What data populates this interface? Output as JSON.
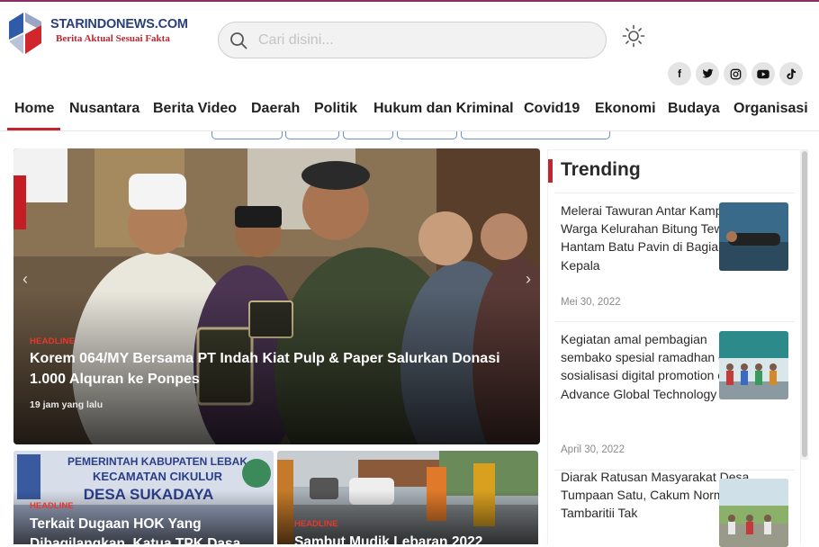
{
  "site": {
    "name": "STARINDONEWS.COM",
    "tagline": "Berita Aktual Sesuai Fakta"
  },
  "search": {
    "placeholder": "Cari disini...",
    "value": ""
  },
  "icons": {
    "theme": "sun-icon",
    "search": "search-icon",
    "socials": [
      "facebook-icon",
      "twitter-icon",
      "instagram-icon",
      "youtube-icon",
      "tiktok-icon"
    ]
  },
  "nav": {
    "items": [
      {
        "label": "Home",
        "active": true
      },
      {
        "label": "Nusantara"
      },
      {
        "label": "Berita Video"
      },
      {
        "label": "Daerah"
      },
      {
        "label": "Politik"
      },
      {
        "label": "Hukum dan Kriminal"
      },
      {
        "label": "Covid19"
      },
      {
        "label": "Ekonomi"
      },
      {
        "label": "Budaya"
      },
      {
        "label": "Organisasi"
      }
    ]
  },
  "hero": {
    "tag": "HEADLINE",
    "title": "Korem 064/MY Bersama PT Indah Kiat Pulp & Paper Salurkan Donasi 1.000 Alquran ke Ponpes",
    "time": "19 jam yang lalu"
  },
  "cards": [
    {
      "tag": "HEADLINE",
      "title": "Terkait Dugaan HOK Yang",
      "title2": "Dibagilangkan, Katua TPK Dasa"
    },
    {
      "tag": "HEADLINE",
      "title": "Sambut Mudik Lebaran 2022"
    }
  ],
  "trending": {
    "heading": "Trending",
    "items": [
      {
        "title": "Melerai Tawuran Antar Kampung, Warga Kelurahan Bitung Tewas di Hantam Batu Pavin di Bagian Kepala",
        "date": "Mei 30, 2022"
      },
      {
        "title": "Kegiatan amal pembagian sembako spesial ramadhan dan sosialisasi digital promotion oleh Advance Global Technology Ltd",
        "date": "April 30, 2022"
      },
      {
        "title": "Diarak Ratusan Masyarakat Desa Tumpaan Satu, Cakum Norman Tambaritii Tak",
        "date": ""
      }
    ]
  },
  "colors": {
    "accent": "#c0262e",
    "brand_blue": "#2a3f7a",
    "headline_tag": "#e8372d"
  }
}
